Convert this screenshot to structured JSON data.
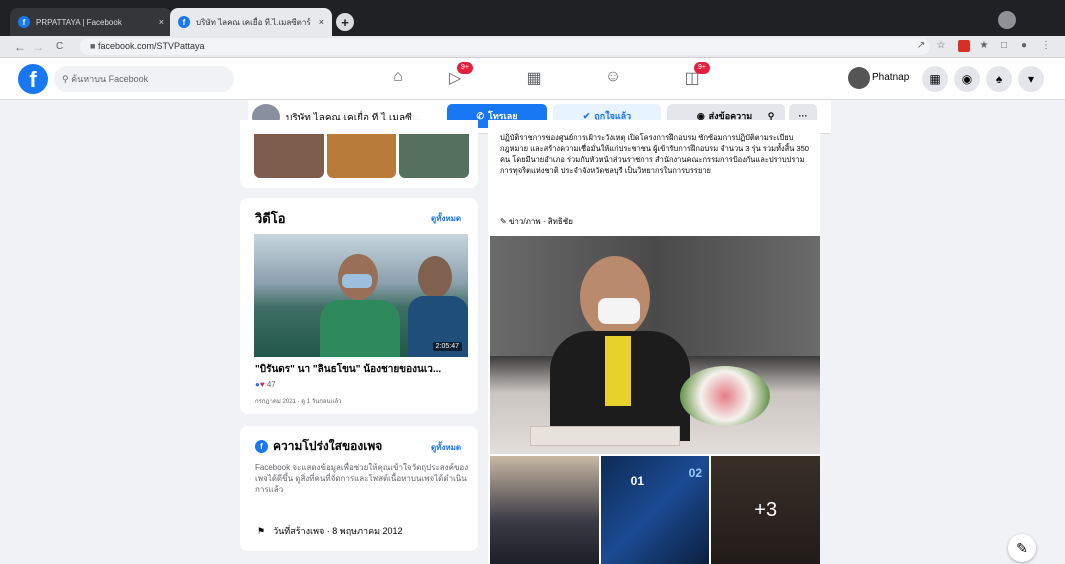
{
  "browser": {
    "tabs": [
      {
        "title": "PRPATTAYA | Facebook",
        "close": "×"
      },
      {
        "title": "บริษัท ไลคณ เคเยื่อ ที.ไ.เมลซีตาร์ ดา...",
        "close": "×"
      }
    ],
    "new_tab": "+",
    "back": "←",
    "forward": "→",
    "reload": "C",
    "url": "facebook.com/STVPattaya"
  },
  "fb": {
    "logo": "f",
    "search_placeholder": "ค้นหาบน Facebook",
    "badges": [
      "9+",
      "9+"
    ],
    "user_name": "Phatnap"
  },
  "page": {
    "name": "บริษัท ไลคณ เคเยื่อ ที.ไ.เมลซี...",
    "buttons": {
      "call": "โทรเลย",
      "like": "ถูกใจแล้ว",
      "message": "ส่งข้อความ",
      "more": "···"
    }
  },
  "video_section": {
    "title": "วิดีโอ",
    "see_all": "ดูทั้งหมด",
    "duration": "2:05:47",
    "video_title": "\"บิรันดร\" นา \"ลินธโขน\" น้องชายของนเว...",
    "reaction_count": "47",
    "meta": "กรกฎาคม 2021 · ดู 1 วันก่อนแล้ว"
  },
  "transparency": {
    "title": "ความโปร่งใสของเพจ",
    "see_all": "ดูทั้งหมด",
    "body": "Facebook จะแสดงข้อมูลเพื่อช่วยให้คุณเข้าใจวัตถุประสงค์ของเพจได้ดีขึ้น ดูสิ่งที่คนที่จัดการและโพสต์เนื้อหาบนเพจได้ดำเนินการแล้ว",
    "created_label": "วันที่สร้างเพจ · 8 พฤษภาคม 2012"
  },
  "post": {
    "text": "ปฏิบัติราชการของศูนย์การเฝ้าระวังเหตุ เปิดโครงการฝึกอบรม ซักซ้อมการปฏิบัติตามระเบียบกฎหมาย และสร้างความเชื่อมั่นให้แก่ประชาชน ผู้เข้ารับการฝึกอบรม จำนวน 3 รุ่น รวมทั้งสิ้น 350 คน โดยมีนายอำเภอ ร่วมกับหัวหน้าส่วนราชการ สำนักงานคณะกรรมการป้องกันและปราบปรามการทุจริตแห่งชาติ ประจำจังหวัดชลบุรี เป็นวิทยากรในการบรรยาย",
    "tags": "ข่าว/ภาพ · สิทธิชัย",
    "more_photos": "+3",
    "sign_01": "01",
    "sign_02": "02"
  }
}
